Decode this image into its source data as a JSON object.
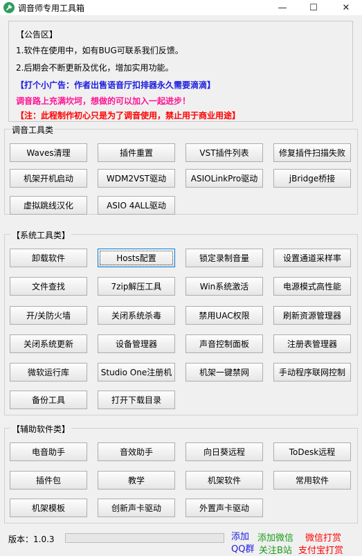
{
  "window": {
    "title": "调音师专用工具箱",
    "min_glyph": "—",
    "max_glyph": "☐",
    "close_glyph": "✕"
  },
  "notice": {
    "heading": "【公告区】",
    "line1": "1.软件在使用中，如有BUG可联系我们反馈。",
    "line2": "2.后期会不断更新及优化，增加实用功能。",
    "ad": "【打个小广告：作者出售语音厅扣排器永久需要滴滴】",
    "invite": "调音路上充满坎坷，想做的可以加入一起进步！",
    "note": "【注：此程制作初心只是为了调音使用，禁止用于商业用途】"
  },
  "tuning": {
    "label": "调音工具类",
    "buttons": [
      "Waves清理",
      "插件重置",
      "VST插件列表",
      "修复插件扫描失败",
      "机架开机启动",
      "WDM2VST驱动",
      "ASIOLinkPro驱动",
      "jBridge桥接",
      "虚拟跳线汉化",
      "ASIO 4ALL驱动"
    ]
  },
  "system": {
    "label": "【系统工具类】",
    "buttons": [
      "卸载软件",
      "Hosts配置",
      "锁定录制音量",
      "设置通道采样率",
      "文件查找",
      "7zip解压工具",
      "Win系统激活",
      "电源模式高性能",
      "开/关防火墙",
      "关闭系统杀毒",
      "禁用UAC权限",
      "刷新资源管理器",
      "关闭系统更新",
      "设备管理器",
      "声音控制面板",
      "注册表管理器",
      "微软运行库",
      "Studio One注册机",
      "机架一键禁网",
      "手动程序联网控制",
      "备份工具",
      "打开下载目录"
    ]
  },
  "aux": {
    "label": "【辅助软件类】",
    "buttons": [
      "电音助手",
      "音效助手",
      "向日葵远程",
      "ToDesk远程",
      "插件包",
      "教学",
      "机架软件",
      "常用软件",
      "机架模板",
      "创新声卡驱动",
      "外置声卡驱动"
    ]
  },
  "footer": {
    "version": "版本：1.0.3",
    "qq_add": "添加",
    "qq_group": "QQ群",
    "wechat_add": "添加微信",
    "bilibili": "关注B站",
    "wechat_tip": "微信打赏",
    "alipay_tip": "支付宝打赏"
  },
  "colors": {
    "blue_link": "#1c1ce0",
    "green_link": "#1a9a1a",
    "red_link": "#ff0000",
    "focus": "#0078d7"
  }
}
